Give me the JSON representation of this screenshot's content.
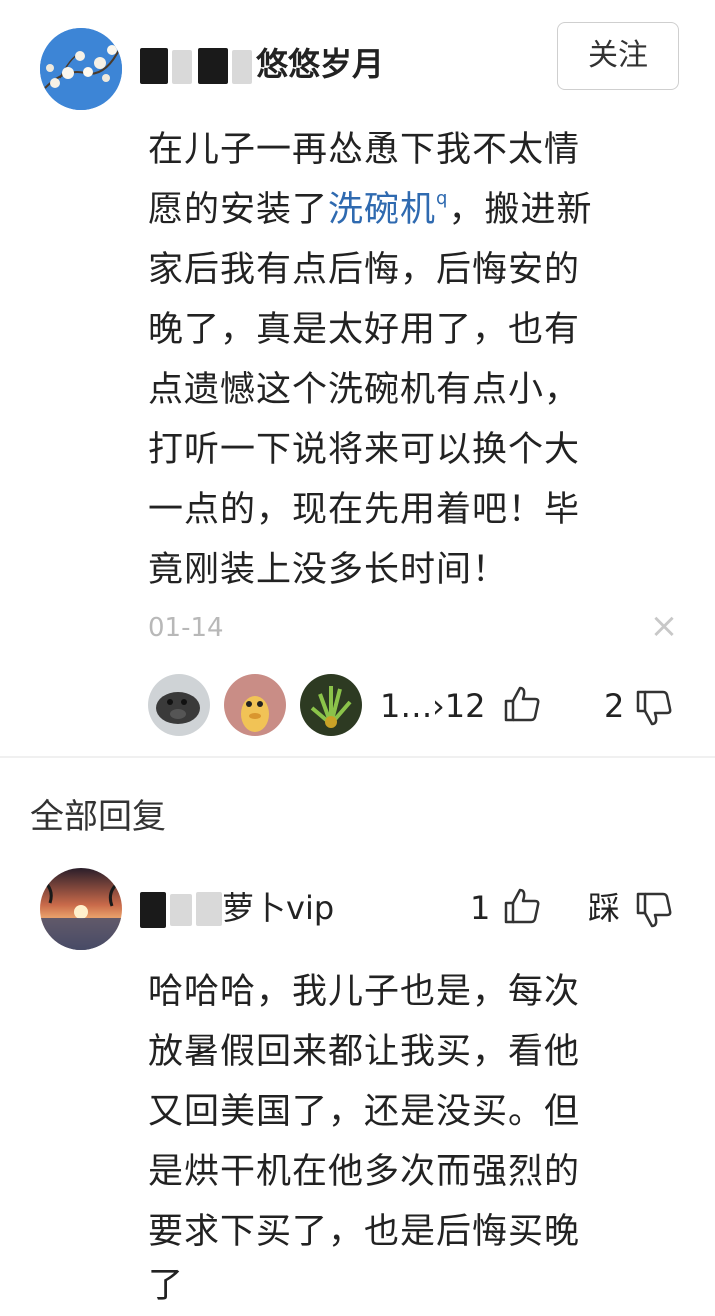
{
  "comment": {
    "username_suffix": "悠悠岁月",
    "follow_label": "关注",
    "body_before_link": "在儿子一再怂恿下我不太情愿的安装了",
    "link_text": "洗碗机",
    "body_after_link": "，搬进新家后我有点后悔，后悔安的晚了，真是太好用了，也有点遗憾这个洗碗机有点小，打听一下说将来可以换个大一点的，现在先用着吧！毕竟刚装上没多长时间！",
    "lines": [
      "在儿子一再怂恿下我不太情",
      "家后我有点后悔，后悔安的",
      "晚了，真是太好用了，也有",
      "点遗憾这个洗碗机有点小，",
      "打听一下说将来可以换个大",
      "一点的，现在先用着吧！毕",
      "竟刚装上没多长时间！"
    ],
    "line2_prefix": "愿的安装了",
    "line2_suffix": "，搬进新",
    "timestamp": "01-14",
    "close_glyph": "×",
    "replies_count_text": "1…",
    "likes_count": "›12",
    "dislikes_count": "2"
  },
  "replies_section": {
    "title": "全部回复"
  },
  "reply": {
    "username_suffix": "萝卜vip",
    "likes_count": "1",
    "dislike_label": "踩",
    "lines": [
      "哈哈哈，我儿子也是，每次",
      "放暑假回来都让我买，看他",
      "又回美国了，还是没买。但",
      "是烘干机在他多次而强烈的",
      "要求下买了，也是后悔买晚",
      "了"
    ]
  },
  "colors": {
    "link": "#2f6ab0",
    "muted": "#b8b8b8",
    "text": "#222222"
  }
}
